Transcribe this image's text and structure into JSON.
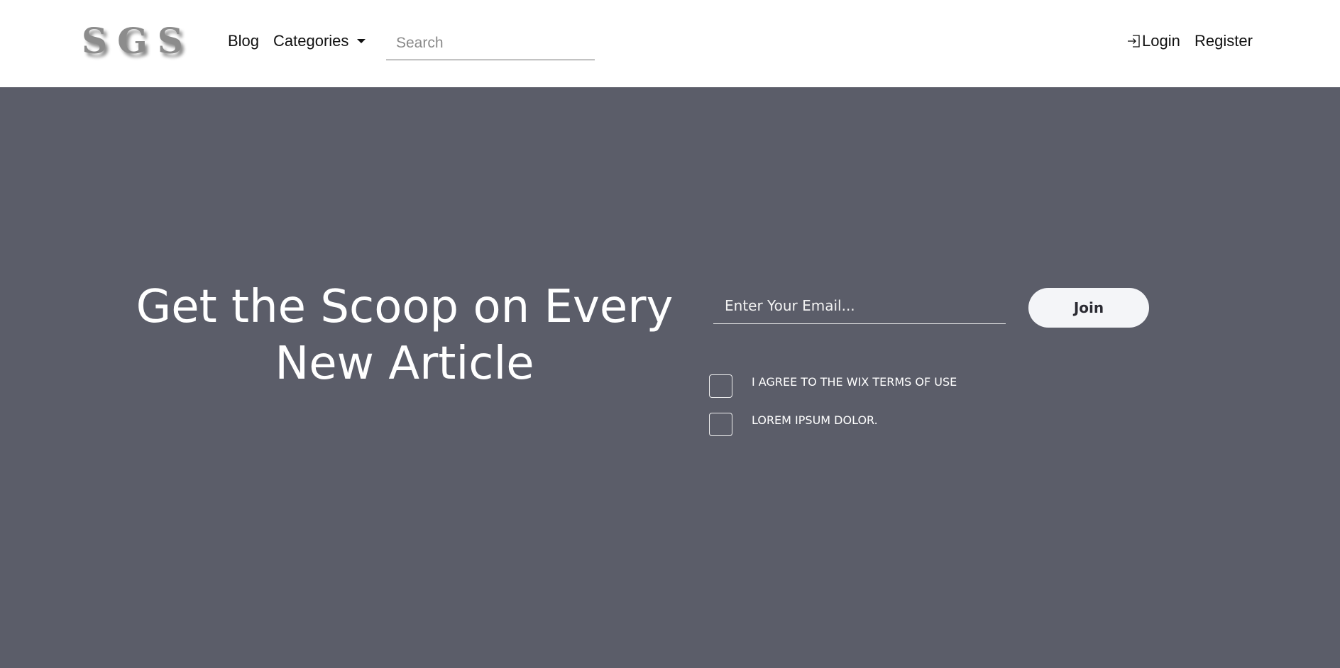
{
  "header": {
    "logo_text": "SGS",
    "nav": {
      "blog_label": "Blog",
      "categories_label": "Categories"
    },
    "search": {
      "placeholder": "Search",
      "value": ""
    },
    "auth": {
      "login_label": "Login",
      "register_label": "Register"
    }
  },
  "hero": {
    "background_color": "#5b5d69",
    "headline_line1": "Get the Scoop on Every",
    "headline_line2": "New Article",
    "email": {
      "placeholder": "Enter Your Email...",
      "value": ""
    },
    "join_label": "Join",
    "checkboxes": [
      {
        "label": "I AGREE TO THE WIX TERMS OF USE",
        "checked": false
      },
      {
        "label": "LOREM IPSUM DOLOR.",
        "checked": false
      }
    ]
  },
  "icons": {
    "login_icon": "sign-in-arrow-icon",
    "categories_caret": "caret-down-icon"
  }
}
